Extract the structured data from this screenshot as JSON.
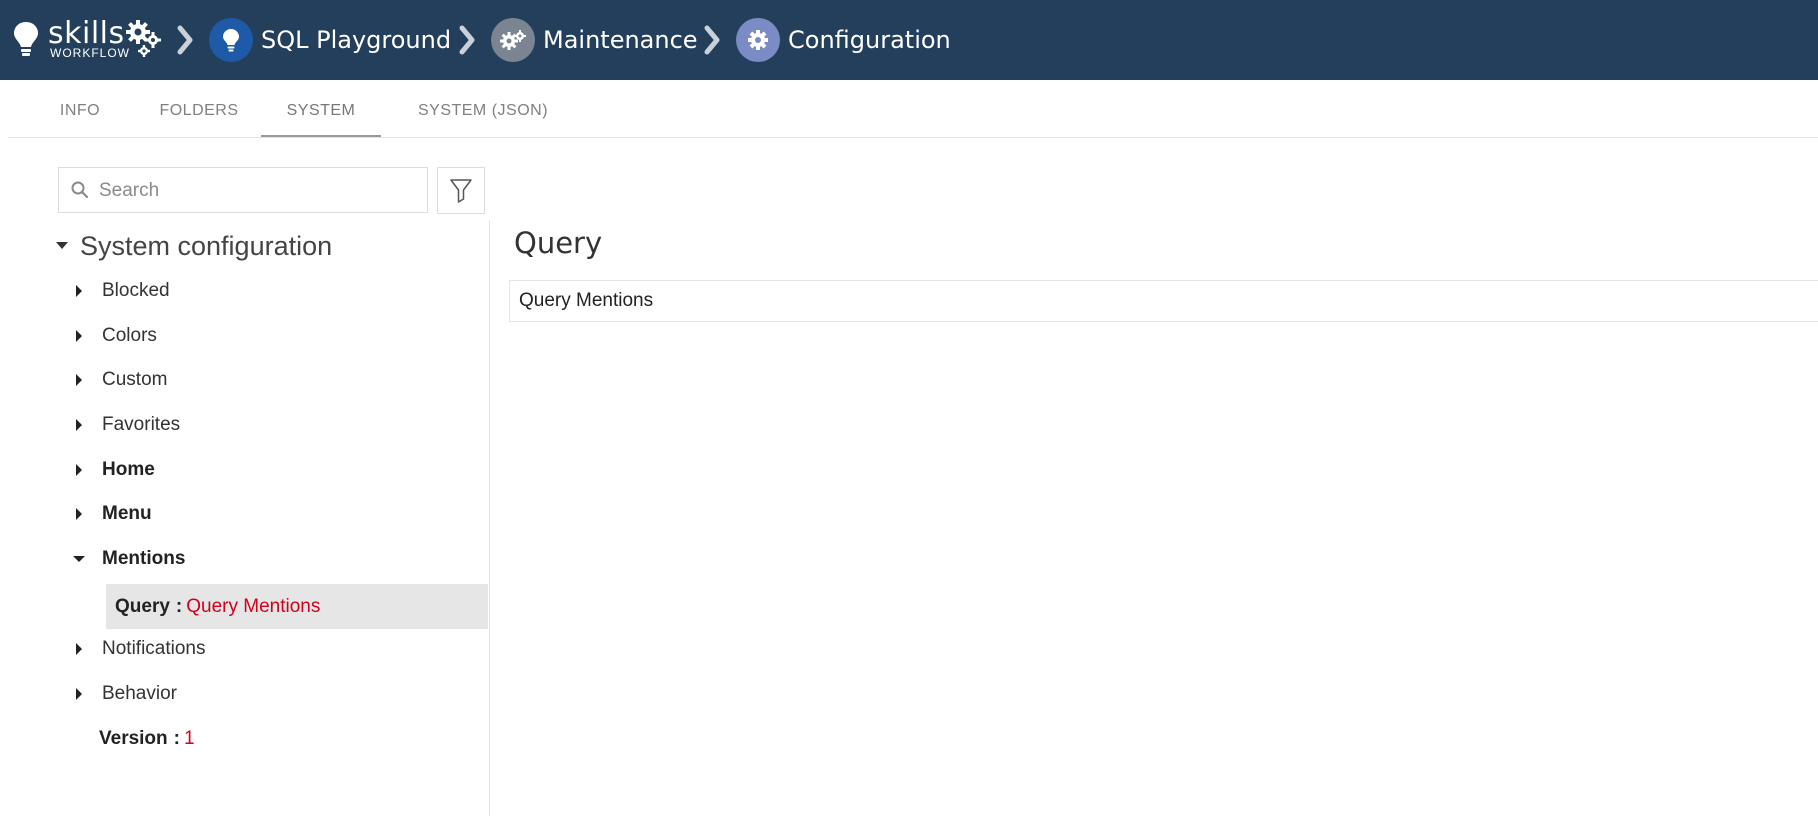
{
  "header": {
    "logo_text": "skills",
    "logo_sub": "WORKFLOW",
    "breadcrumbs": [
      {
        "label": "SQL Playground",
        "icon": "bulb-icon",
        "color": "#1e5aa8"
      },
      {
        "label": "Maintenance",
        "icon": "gears-icon",
        "color": "#7a8591"
      },
      {
        "label": "Configuration",
        "icon": "gear-icon",
        "color": "#7b8bc6"
      }
    ]
  },
  "tabs": [
    {
      "label": "INFO",
      "active": false
    },
    {
      "label": "FOLDERS",
      "active": false
    },
    {
      "label": "SYSTEM",
      "active": true
    },
    {
      "label": "SYSTEM (JSON)",
      "active": false
    }
  ],
  "search": {
    "placeholder": "Search",
    "value": ""
  },
  "tree": {
    "root": "System configuration",
    "items": [
      {
        "label": "Blocked",
        "bold": false,
        "expanded": false
      },
      {
        "label": "Colors",
        "bold": false,
        "expanded": false
      },
      {
        "label": "Custom",
        "bold": false,
        "expanded": false
      },
      {
        "label": "Favorites",
        "bold": false,
        "expanded": false
      },
      {
        "label": "Home",
        "bold": true,
        "expanded": false
      },
      {
        "label": "Menu",
        "bold": true,
        "expanded": false
      },
      {
        "label": "Mentions",
        "bold": true,
        "expanded": true
      },
      {
        "label": "Notifications",
        "bold": false,
        "expanded": false
      },
      {
        "label": "Behavior",
        "bold": false,
        "expanded": false
      }
    ],
    "selected_leaf": {
      "key": "Query",
      "sep": ":",
      "value": "Query Mentions"
    },
    "version": {
      "key": "Version",
      "sep": ":",
      "value": "1"
    }
  },
  "detail": {
    "title": "Query",
    "value": "Query Mentions"
  },
  "colors": {
    "header_bg": "#233f5b",
    "value_red": "#d0021b",
    "selected_bg": "#e6e6e6"
  }
}
